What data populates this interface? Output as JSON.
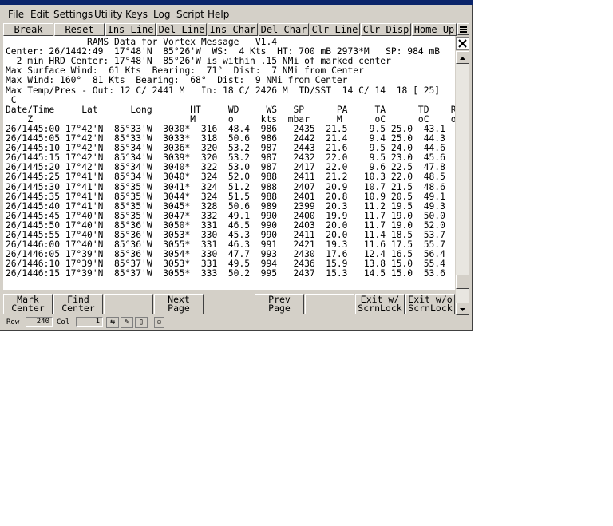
{
  "menu": [
    "File",
    "Edit",
    "Settings",
    "Utility",
    "Keys",
    "Log",
    "Script",
    "Help"
  ],
  "toolbar": [
    "Break",
    "Reset",
    "Ins Line",
    "Del Line",
    "Ins Char",
    "Del Char",
    "Clr Line",
    "Clr Disp",
    "Home Up"
  ],
  "terminal_lines": [
    "               RAMS Data for Vortex Message   V1.4",
    "Center: 26/1442:49  17°48'N  85°26'W  WS:  4 Kts  HT: 700 mB 2973*M   SP: 984 mB",
    "  2 min HRD Center: 17°48'N  85°26'W is within .15 NMi of marked center",
    "Max Surface Wind:  61 Kts  Bearing:  71°  Dist:  7 NMi from Center",
    "Max Wind: 160°  81 Kts  Bearing:  68°  Dist:  9 NMi from Center",
    "Max Temp/Pres - Out: 12 C/ 2441 M   In: 18 C/ 2426 M  TD/SST  14 C/ 14  18 [ 25]",
    " C",
    "Date/Time     Lat      Long       HT     WD     WS   SP      PA     TA      TD    RD   SFWS",
    "    Z                             M      o     kts  mbar     M      oC      oC    oC   kts",
    "26/1445:00 17°42'N  85°33'W  3030*  316  48.4  986   2435  21.5    9.5 25.0  43.1",
    "26/1445:05 17°42'N  85°33'W  3033*  318  50.6  986   2442  21.4    9.4 25.0  44.3",
    "26/1445:10 17°42'N  85°34'W  3036*  320  53.2  987   2443  21.6    9.5 24.0  44.6",
    "26/1445:15 17°42'N  85°34'W  3039*  320  53.2  987   2432  22.0    9.5 23.0  45.6",
    "26/1445:20 17°42'N  85°34'W  3040*  322  53.0  987   2417  22.0    9.6 22.5  47.8",
    "26/1445:25 17°41'N  85°34'W  3040*  324  52.0  988   2411  21.2   10.3 22.0  48.5",
    "26/1445:30 17°41'N  85°35'W  3041*  324  51.2  988   2407  20.9   10.7 21.5  48.6",
    "26/1445:35 17°41'N  85°35'W  3044*  324  51.5  988   2401  20.8   10.9 20.5  49.1",
    "26/1445:40 17°41'N  85°35'W  3045*  328  50.6  989   2399  20.3   11.2 19.5  49.3",
    "26/1445:45 17°40'N  85°35'W  3047*  332  49.1  990   2400  19.9   11.7 19.0  50.0",
    "26/1445:50 17°40'N  85°36'W  3050*  331  46.5  990   2403  20.0   11.7 19.0  52.0",
    "26/1445:55 17°40'N  85°36'W  3053*  330  45.3  990   2411  20.0   11.4 18.5  53.7",
    "26/1446:00 17°40'N  85°36'W  3055*  331  46.3  991   2421  19.3   11.6 17.5  55.7",
    "26/1446:05 17°39'N  85°36'W  3054*  330  47.7  993   2430  17.6   12.4 16.5  56.4",
    "26/1446:10 17°39'N  85°37'W  3053*  331  49.5  994   2436  15.9   13.8 15.0  55.4",
    "26/1446:15 17°39'N  85°37'W  3055*  333  50.2  995   2437  15.3   14.5 15.0  53.6"
  ],
  "function_keys": [
    {
      "line1": "Mark",
      "line2": "Center"
    },
    {
      "line1": "Find",
      "line2": "Center"
    },
    {
      "line1": "",
      "line2": ""
    },
    {
      "line1": "Next",
      "line2": "Page"
    },
    {
      "line1": "Prev",
      "line2": "Page"
    },
    {
      "line1": "",
      "line2": ""
    },
    {
      "line1": "Exit w/",
      "line2": "ScrnLock"
    },
    {
      "line1": "Exit w/o",
      "line2": "ScrnLock"
    }
  ],
  "status": {
    "row_label": "Row",
    "row_value": "240",
    "col_label": "Col",
    "col_value": "1"
  },
  "icons": {
    "close": "close-icon",
    "menu": "menu-lines-icon",
    "scroll_up": "arrow-up-icon",
    "scroll_down": "arrow-down-icon"
  }
}
